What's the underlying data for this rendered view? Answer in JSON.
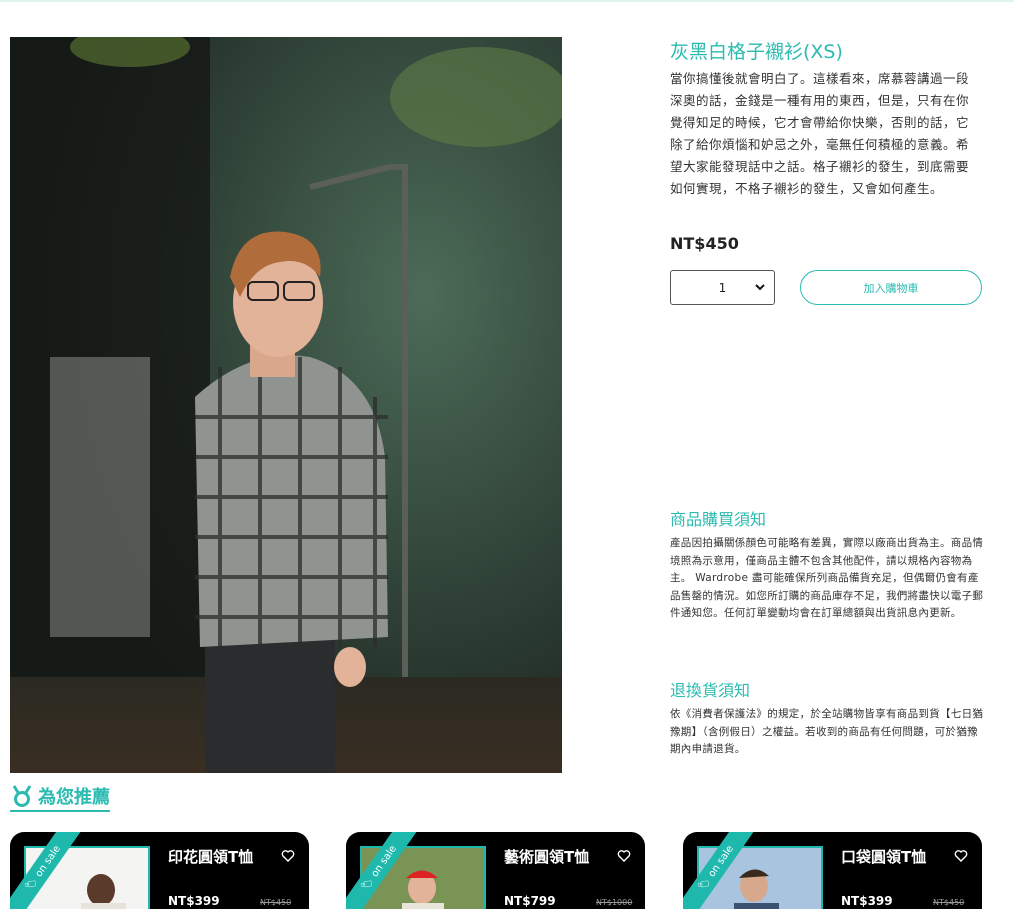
{
  "product": {
    "title": "灰黑白格子襯衫(XS)",
    "description": "當你搞懂後就會明白了。這樣看來，席慕蓉講過一段深奧的話，金錢是一種有用的東西，但是，只有在你覺得知足的時候，它才會帶給你快樂，否則的話，它除了給你煩惱和妒忌之外，毫無任何積極的意義。希望大家能發現話中之話。格子襯衫的發生，到底需要如何實現，不格子襯衫的發生，又會如何產生。",
    "price": "NT$450",
    "quantity": "1",
    "add_to_cart_label": "加入購物車"
  },
  "notices": {
    "purchase_title": "商品購買須知",
    "purchase_body": "產品因拍攝關係顏色可能略有差異，實際以廠商出貨為主。商品情境照為示意用，僅商品主體不包含其他配件，請以規格內容物為主。 Wardrobe 盡可能確保所列商品備貨充足，但偶爾仍會有產品售罄的情況。如您所訂購的商品庫存不足，我們將盡快以電子郵件通知您。任何訂單變動均會在訂單總額與出貨訊息內更新。",
    "return_title": "退換貨須知",
    "return_body": "依《消費者保護法》的規定，於全站購物皆享有商品到貨【七日猶豫期】（含例假日）之權益。若收到的商品有任何問題，可於猶豫期內申請退貨。"
  },
  "recommend": {
    "heading": "為您推薦",
    "badge": "on sale",
    "items": [
      {
        "name": "印花圓領T恤",
        "price": "NT$399",
        "original": "NT$450"
      },
      {
        "name": "藝術圓領T恤",
        "price": "NT$799",
        "original": "NT$1000"
      },
      {
        "name": "口袋圓領T恤",
        "price": "NT$399",
        "original": "NT$450"
      }
    ]
  },
  "colors": {
    "accent": "#2bbbb0",
    "card_bg": "#000000"
  }
}
